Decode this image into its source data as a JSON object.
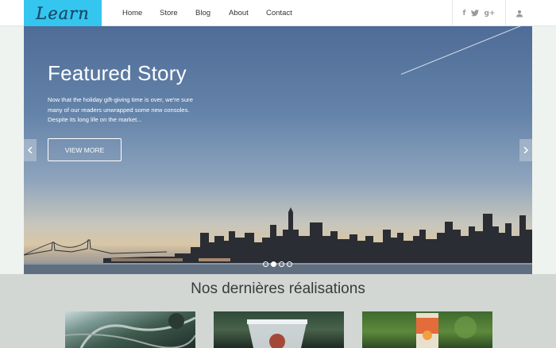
{
  "header": {
    "logo_text": "Learn",
    "logo_color": "#35c6f0",
    "nav": {
      "home": "Home",
      "store": "Store",
      "blog": "Blog",
      "about": "About",
      "contact": "Contact"
    },
    "social": {
      "facebook": "f",
      "twitter": "twitter-icon",
      "google": "g+"
    },
    "user_icon": "user-icon"
  },
  "hero": {
    "title": "Featured Story",
    "text": "Now that the holiday gift-giving time is over, we're sure many of our readers unwrapped some new consoles. Despite its long life on the market...",
    "button_label": "VIEW MORE",
    "prev_icon": "chevron-left-icon",
    "next_icon": "chevron-right-icon",
    "slides_total": 4,
    "slide_active": 2
  },
  "section": {
    "title": "Nos dernières réalisations"
  }
}
